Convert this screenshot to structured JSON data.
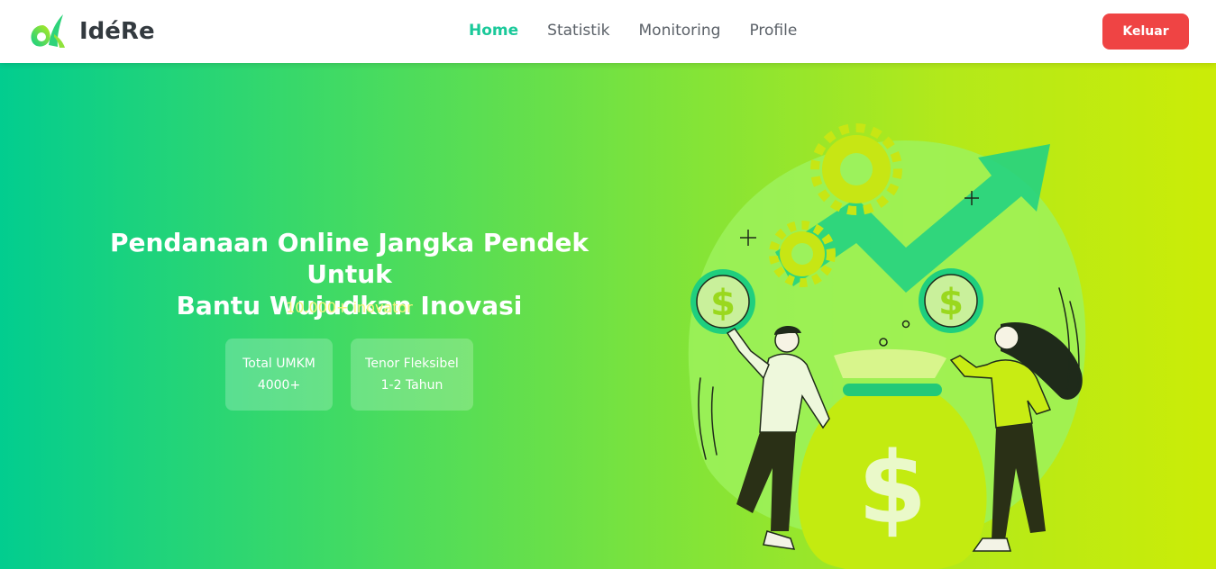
{
  "brand": {
    "name": "IdéRe",
    "logo_icon": "leaf-d-logo-icon"
  },
  "nav": {
    "items": [
      {
        "label": "Home",
        "active": true
      },
      {
        "label": "Statistik",
        "active": false
      },
      {
        "label": "Monitoring",
        "active": false
      },
      {
        "label": "Profile",
        "active": false
      }
    ]
  },
  "logout_label": "Keluar",
  "hero": {
    "title_line1": "Pendanaan Online Jangka Pendek Untuk",
    "title_line2": "Bantu Wujudkan Inovasi",
    "subtitle": "10.000+ inovator",
    "stats": [
      {
        "label": "Total UMKM",
        "value": "4000+"
      },
      {
        "label": "Tenor Fleksibel",
        "value": "1-2 Tahun"
      }
    ],
    "illustration_icon": "money-growth-illustration"
  },
  "colors": {
    "accent": "#1ac99a",
    "danger": "#ef4444",
    "gradient_start": "#02cd8f",
    "gradient_end": "#cbec07",
    "subtitle": "#f4f57a"
  }
}
